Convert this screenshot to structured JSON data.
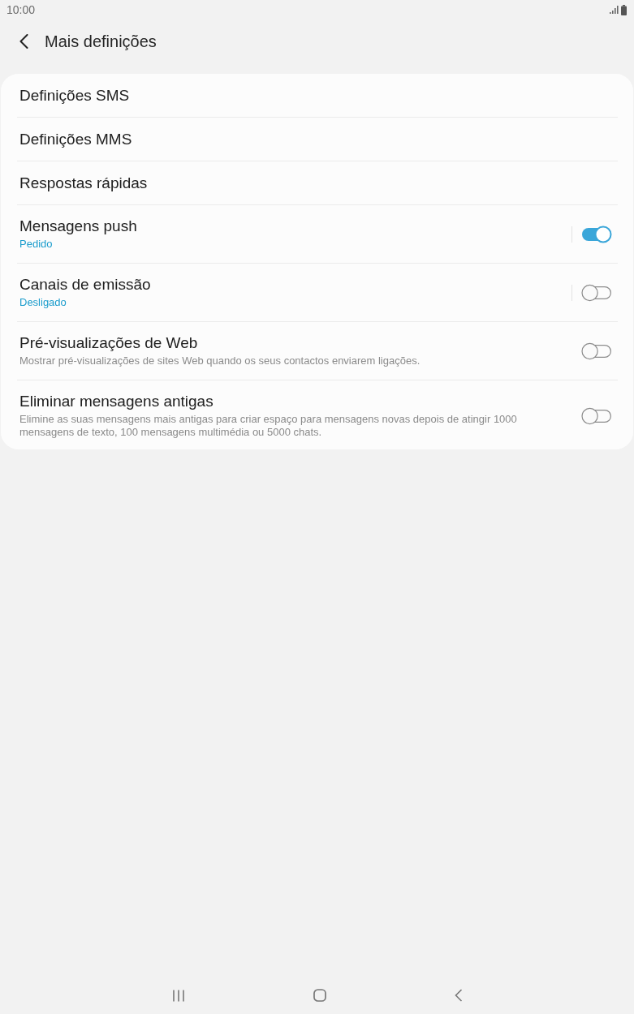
{
  "status_bar": {
    "time": "10:00"
  },
  "header": {
    "title": "Mais definições"
  },
  "settings": [
    {
      "kind": "link",
      "title": "Definições SMS"
    },
    {
      "kind": "link",
      "title": "Definições MMS"
    },
    {
      "kind": "link",
      "title": "Respostas rápidas"
    },
    {
      "kind": "split",
      "title": "Mensagens push",
      "status": "Pedido",
      "on": true
    },
    {
      "kind": "split",
      "title": "Canais de emissão",
      "status": "Desligado",
      "on": false
    },
    {
      "kind": "switch",
      "title": "Pré-visualizações de Web",
      "description": "Mostrar pré-visualizações de sites Web quando os seus contactos enviarem ligações.",
      "on": false
    },
    {
      "kind": "switch",
      "title": "Eliminar mensagens antigas",
      "description": "Elimine as suas mensagens mais antigas para criar espaço para mensagens novas depois de atingir 1000 mensagens de texto, 100 mensagens multimédia ou 5000 chats.",
      "on": false
    }
  ]
}
